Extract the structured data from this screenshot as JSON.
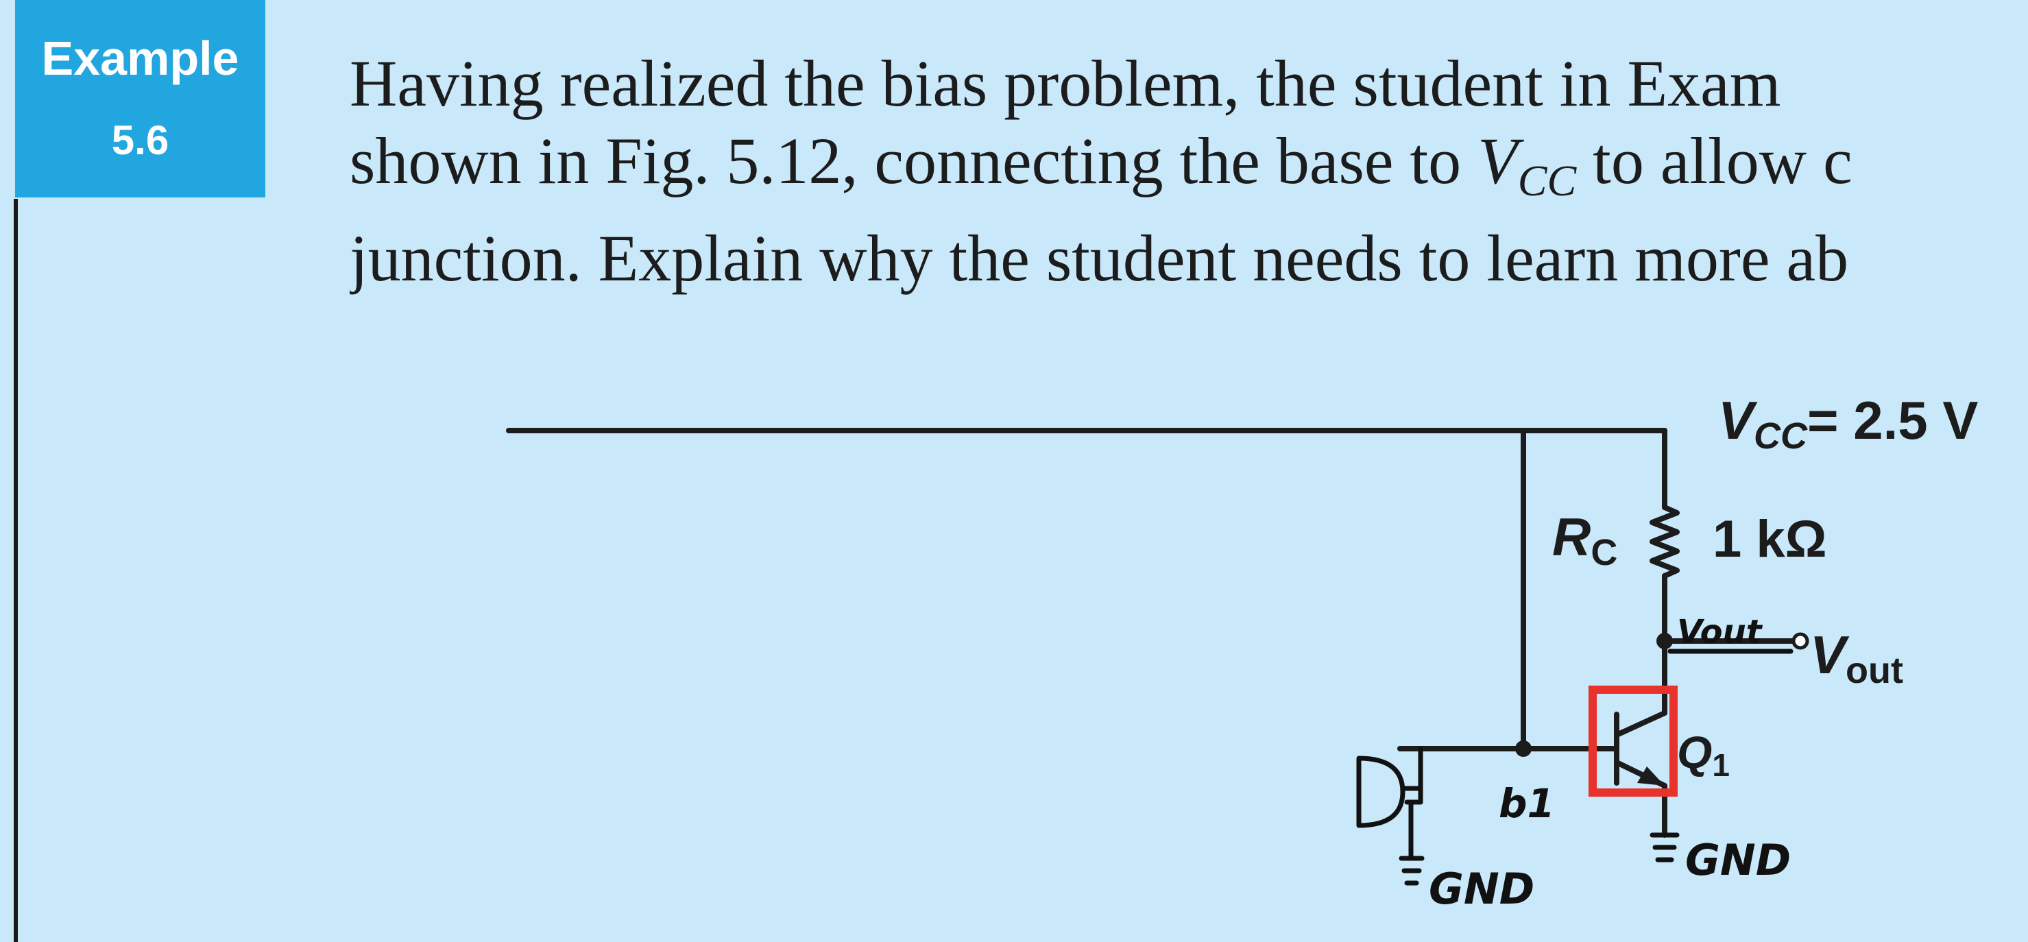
{
  "example": {
    "label": "Example",
    "number": "5.6",
    "badge_color": "#22a6e0"
  },
  "problem": {
    "line1": "Having realized the bias problem, the student in Exam",
    "line2_before": "shown in Fig. 5.12, connecting the base to ",
    "line2_var": "V",
    "line2_sub": "CC",
    "line2_after": " to allow c",
    "line3": "junction. Explain why the student needs to learn more ab"
  },
  "circuit": {
    "vcc_var": "V",
    "vcc_sub": "CC",
    "vcc_value": "= 2.5 V",
    "rc_var": "R",
    "rc_sub": "C",
    "rc_value": "1 kΩ",
    "vout_var": "V",
    "vout_sub": "out",
    "q_var": "Q",
    "q_sub": "1",
    "annotations": {
      "vout_handwritten": "Vout",
      "b1_handwritten": "b1",
      "gnd_left": "GND",
      "gnd_right": "GND",
      "annotation_color": "#111111",
      "highlight_color": "#e8322c"
    }
  }
}
